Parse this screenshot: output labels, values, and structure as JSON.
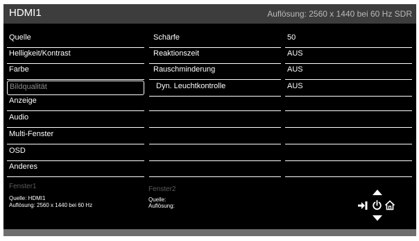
{
  "header": {
    "input_name": "HDMI1",
    "resolution_info": "Auflösung: 2560 x 1440 bei 60 Hz SDR"
  },
  "menu": [
    {
      "label": "Quelle"
    },
    {
      "label": "Helligkeit/Kontrast"
    },
    {
      "label": "Farbe"
    },
    {
      "label": "Bildqualität"
    },
    {
      "label": "Anzeige"
    },
    {
      "label": "Audio"
    },
    {
      "label": "Multi-Fenster"
    },
    {
      "label": "OSD"
    },
    {
      "label": "Anderes"
    }
  ],
  "settings": [
    {
      "label": "Schärfe",
      "value": "50"
    },
    {
      "label": "Reaktionszeit",
      "value": "AUS"
    },
    {
      "label": "Rauschminderung",
      "value": "AUS"
    },
    {
      "label": "Dyn. Leuchtkontrolle",
      "value": "AUS"
    }
  ],
  "window1": {
    "title": "Fenster1",
    "source": "Quelle: HDMI1",
    "resolution": "Auflösung: 2560 x 1440 bei 60 Hz"
  },
  "window2": {
    "title": "Fenster2",
    "source": "Quelle:",
    "resolution": "Auflösung:"
  },
  "icons": {
    "up": "arrow-up-icon",
    "down": "arrow-down-icon",
    "input": "input-icon",
    "power": "power-icon",
    "home": "home-icon"
  },
  "colors": {
    "background": "#000000",
    "titlebar": "#3d3d3d",
    "selected_text": "#8a8a8a",
    "dimmed_text": "#5c5c5c"
  }
}
